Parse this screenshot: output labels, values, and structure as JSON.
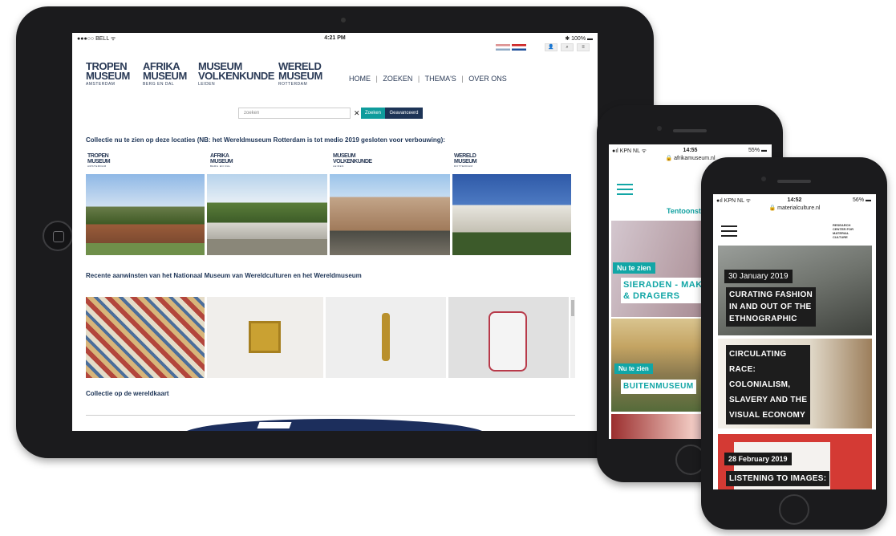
{
  "ipad": {
    "status": {
      "carrier": "●●●○○ BELL ᯤ",
      "time": "4:21 PM",
      "battery": "✱ 100% ▬"
    },
    "logos": [
      {
        "line1": "TROPEN",
        "line2": "MUSEUM",
        "sub": "AMSTERDAM"
      },
      {
        "line1": "AFRIKA",
        "line2": "MUSEUM",
        "sub": "BERG EN DAL"
      },
      {
        "line1": "MUSEUM",
        "line2": "VOLKENKUNDE",
        "sub": "LEIDEN"
      },
      {
        "line1": "WERELD",
        "line2": "MUSEUM",
        "sub": "ROTTERDAM"
      }
    ],
    "nav": [
      "HOME",
      "ZOEKEN",
      "THEMA'S",
      "OVER ONS"
    ],
    "nav_sep": "|",
    "icons": [
      "user-icon",
      "search-icon",
      "menu-icon"
    ],
    "search": {
      "value": "zoeken",
      "search_btn": "Zoeken",
      "advanced_btn": "Geavanceerd"
    },
    "headings": {
      "locations": "Collectie nu te zien op deze locaties (NB: het Wereldmuseum Rotterdam is tot medio 2019 gesloten voor verbouwing):",
      "acquisitions": "Recente aanwinsten van het Nationaal Museum van Wereldculturen en het Wereldmuseum",
      "map": "Collectie op de wereldkaart"
    }
  },
  "phone1": {
    "status": {
      "carrier": "●ıl KPN NL ᯤ",
      "time": "14:55",
      "battery": "55% ▬",
      "url": "🔒 afrikamuseum.nl"
    },
    "section": "Tentoonstellingen",
    "cards": [
      {
        "tag": "Nu te zien",
        "title_line1": "SIERADEN - MAKERS",
        "title_line2": "& DRAGERS"
      },
      {
        "tag": "Nu te zien",
        "title_line1": "BUITENMUSEUM"
      }
    ]
  },
  "phone2": {
    "status": {
      "carrier": "●ıl KPN NL ᯤ",
      "time": "14:52",
      "battery": "56% ▬",
      "url": "🔒 materialculture.nl"
    },
    "logo": [
      "RESEARCH",
      "CENTER FOR",
      "MATERIAL",
      "CULTURE"
    ],
    "cards": [
      {
        "date": "30 January 2019",
        "lines": [
          "CURATING FASHION",
          "IN AND OUT OF THE",
          "ETHNOGRAPHIC"
        ]
      },
      {
        "lines": [
          "CIRCULATING",
          "RACE:",
          "COLONIALISM,",
          "SLAVERY AND THE",
          "VISUAL ECONOMY"
        ]
      },
      {
        "date": "28 February 2019",
        "lines": [
          "LISTENING TO IMAGES:"
        ]
      }
    ]
  }
}
